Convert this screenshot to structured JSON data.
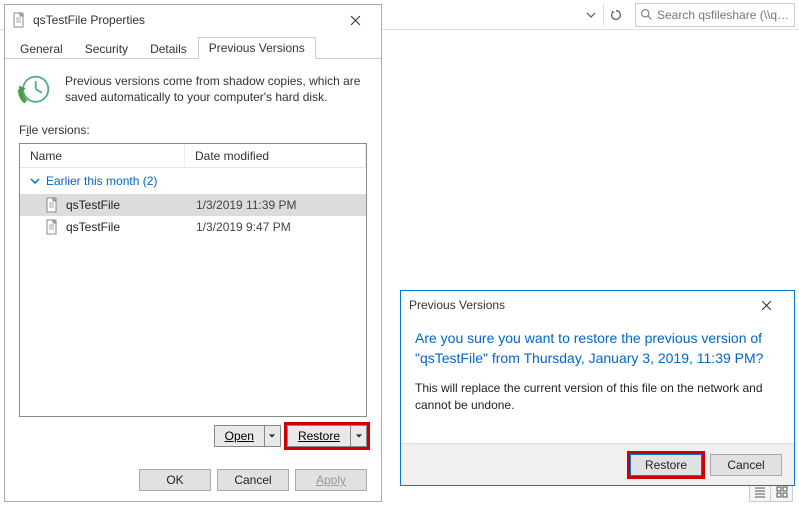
{
  "explorer": {
    "search_placeholder": "Search qsfileshare (\\\\qsstorag..."
  },
  "properties": {
    "title": "qsTestFile Properties",
    "tabs": [
      "General",
      "Security",
      "Details",
      "Previous Versions"
    ],
    "active_tab_index": 3,
    "info_text": "Previous versions come from shadow copies, which are saved automatically to your computer's hard disk.",
    "file_versions_label_pre": "F",
    "file_versions_label_u": "i",
    "file_versions_label_post": "le versions:",
    "columns": {
      "name": "Name",
      "date": "Date modified"
    },
    "group_label": "Earlier this month (2)",
    "rows": [
      {
        "name": "qsTestFile",
        "date": "1/3/2019 11:39 PM",
        "selected": true
      },
      {
        "name": "qsTestFile",
        "date": "1/3/2019 9:47 PM",
        "selected": false
      }
    ],
    "open_label": "Open",
    "restore_label": "Restore",
    "ok_label": "OK",
    "cancel_label": "Cancel",
    "apply_label": "Apply"
  },
  "confirm": {
    "title": "Previous Versions",
    "main_text": "Are you sure you want to restore the previous version of \"qsTestFile\" from Thursday, January 3, 2019, 11:39 PM?",
    "sub_text": "This will replace the current version of this file on the network and cannot be undone.",
    "restore_label": "Restore",
    "cancel_label": "Cancel"
  }
}
